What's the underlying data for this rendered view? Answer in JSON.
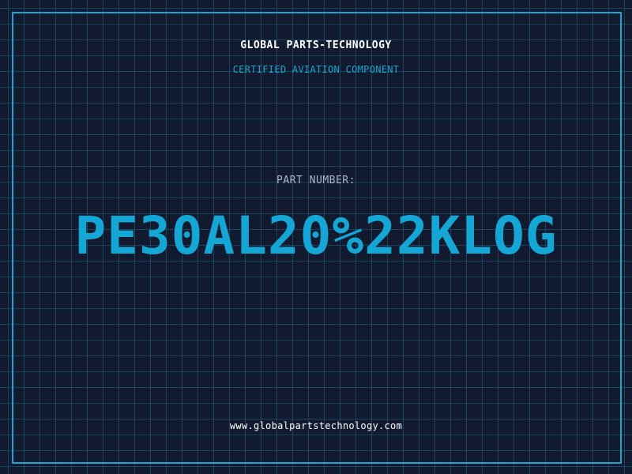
{
  "header": {
    "company_name": "GLOBAL PARTS-TECHNOLOGY",
    "subtitle": "CERTIFIED AVIATION COMPONENT"
  },
  "part": {
    "label": "PART NUMBER:",
    "number": "PE30AL20%22KLOG"
  },
  "footer": {
    "website": "www.globalpartstechnology.com"
  },
  "colors": {
    "background": "#111a2e",
    "grid": "#227896",
    "accent": "#1aa6cf",
    "text": "#ffffff"
  }
}
